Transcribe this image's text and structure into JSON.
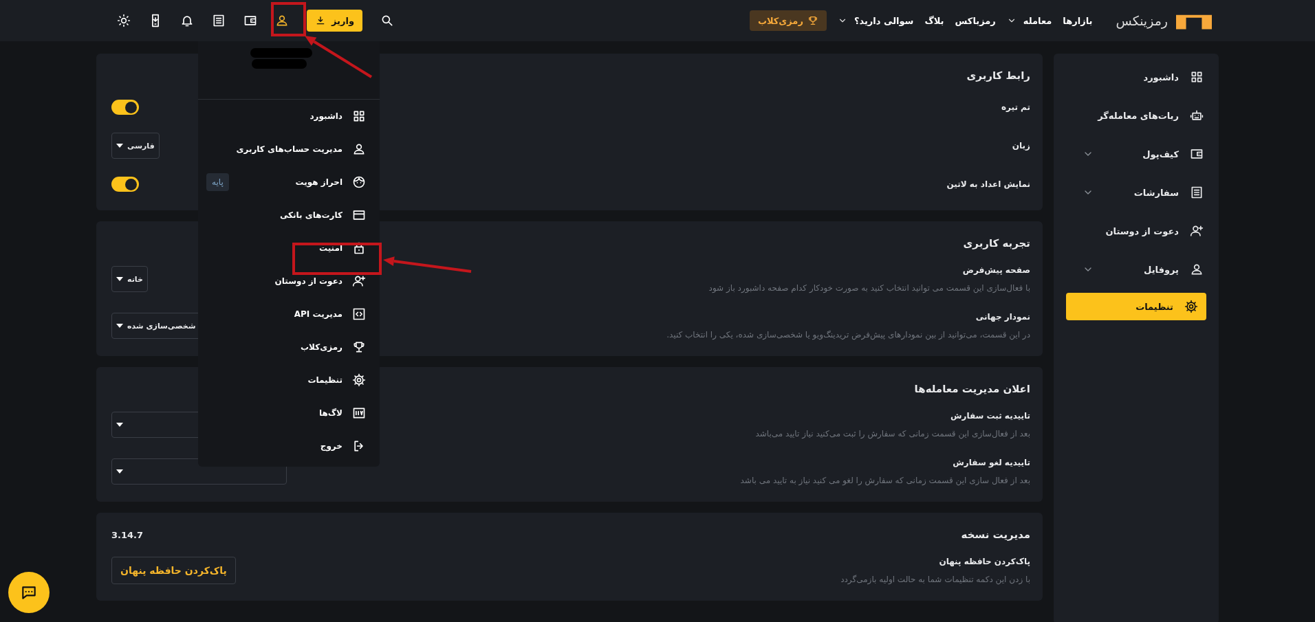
{
  "header": {
    "logo": "رمزینکس",
    "nav": [
      {
        "label": "بازارها",
        "has_menu": false
      },
      {
        "label": "معامله",
        "has_menu": true
      },
      {
        "label": "رمزباکس",
        "has_menu": false
      },
      {
        "label": "بلاگ",
        "has_menu": false
      },
      {
        "label": "سوالی دارید؟",
        "has_menu": true
      }
    ],
    "club_button": "رمزی‌کلاب",
    "deposit_button": "واریز",
    "account_menu_open": true
  },
  "account_menu": {
    "items": [
      {
        "label": "داشبورد"
      },
      {
        "label": "مدیریت حساب‌های کاربری"
      },
      {
        "label": "احراز هویت",
        "badge": "پایه"
      },
      {
        "label": "کارت‌های بانکی"
      },
      {
        "label": "امنیت"
      },
      {
        "label": "دعوت از دوستان"
      },
      {
        "label": "مدیریت API"
      },
      {
        "label": "رمزی‌کلاب"
      },
      {
        "label": "تنظیمات"
      },
      {
        "label": "لاگ‌ها"
      },
      {
        "label": "خروج"
      }
    ]
  },
  "sidebar": {
    "items": [
      {
        "label": "داشبورد",
        "expandable": false,
        "selected": false
      },
      {
        "label": "ربات‌های معامله‌گر",
        "expandable": false,
        "selected": false
      },
      {
        "label": "کیف‌پول",
        "expandable": true,
        "selected": false
      },
      {
        "label": "سفارشات",
        "expandable": true,
        "selected": false
      },
      {
        "label": "دعوت از دوستان",
        "expandable": false,
        "selected": false
      },
      {
        "label": "پروفایل",
        "expandable": true,
        "selected": false
      },
      {
        "label": "تنظیمات",
        "expandable": false,
        "selected": true
      }
    ]
  },
  "sections": [
    {
      "title": "رابط کاربری",
      "rows": [
        {
          "label": "تم تیره",
          "kind": "toggle",
          "on": true
        },
        {
          "label": "زبان",
          "kind": "select",
          "value": "فارسی"
        },
        {
          "label": "نمایش اعداد به لاتین",
          "kind": "toggle",
          "on": true
        }
      ]
    },
    {
      "title": "تجربه کاربری",
      "rows": [
        {
          "label": "صفحه پیش‌فرض",
          "description": "با فعال‌سازی این قسمت می توانید انتخاب کنید به صورت خودکار کدام صفحه داشبورد باز شود",
          "kind": "select",
          "value": "خانه"
        },
        {
          "label": "نمودار جهانی",
          "description": "در این قسمت، می‌توانید از بین نمودارهای پیش‌فرض تریدینگ‌ویو یا شخصی‌سازی شده، یکی را انتخاب کنید.",
          "kind": "select",
          "value": "شخصی‌سازی شده"
        }
      ]
    },
    {
      "title": "اعلان مدیریت معامله‌ها",
      "rows": [
        {
          "label": "تاییدیه ثبت سفارش",
          "description": "بعد از فعال‌سازی این قسمت زمانی که سفارش را ثبت می‌کنید نیاز تایید می‌باشد",
          "kind": "select"
        },
        {
          "label": "تاییدیه لغو سفارش",
          "description": "بعد از فعال سازی این قسمت زمانی که سفارش را لغو می کنید نیاز به تایید می باشد",
          "kind": "select"
        }
      ]
    },
    {
      "title": "مدیریت نسخه",
      "version": "3.14.7",
      "rows": [
        {
          "label": "پاک‌کردن حافظه پنهان",
          "description": "با زدن این دکمه تنظیمات شما به حالت اولیه بازمی‌گردد",
          "kind": "button",
          "button": "پاک‌کردن حافظه پنهان"
        }
      ]
    }
  ]
}
